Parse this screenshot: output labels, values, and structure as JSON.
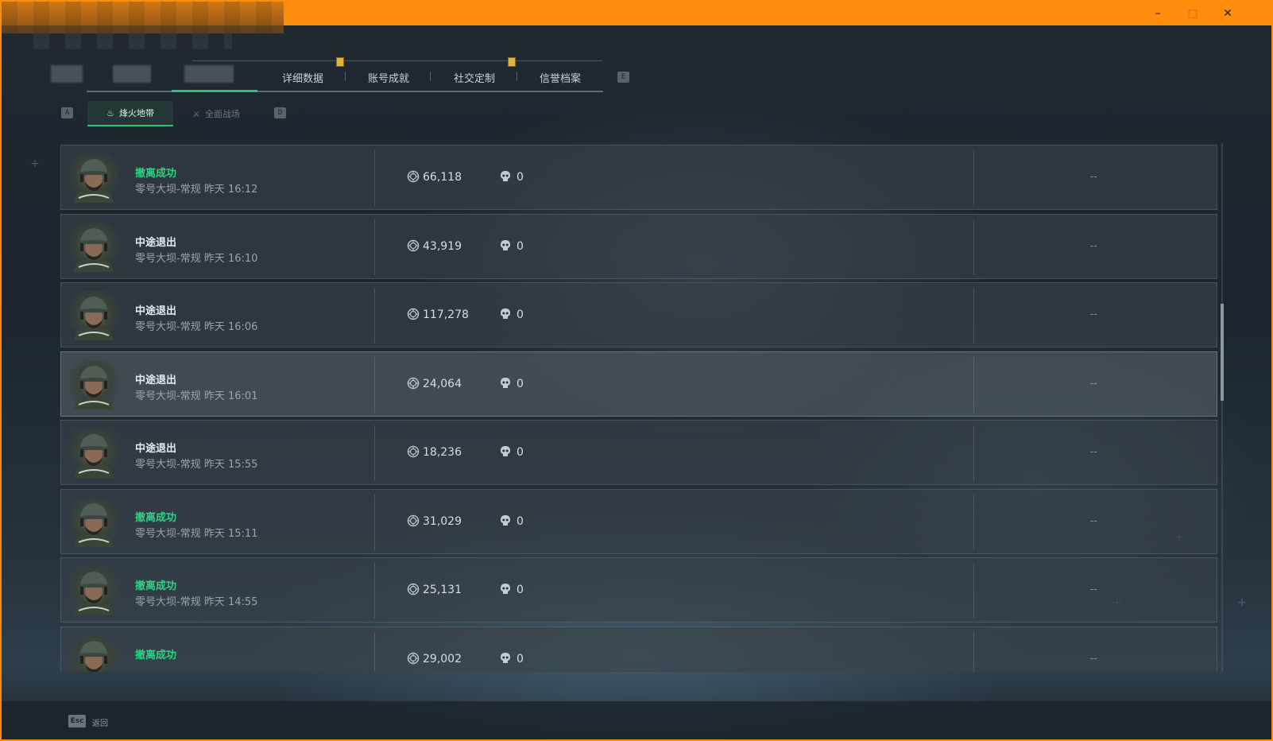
{
  "window": {
    "controls": {
      "minimize": "–",
      "maximize": "□",
      "close": "✕"
    },
    "accent_color": "#ff8c0a"
  },
  "tabs": {
    "items": [
      {
        "label": "详细数据"
      },
      {
        "label": "账号成就"
      },
      {
        "label": "社交定制"
      },
      {
        "label": "信誉档案"
      }
    ],
    "next_key": "E",
    "prev_key": "Q"
  },
  "subtabs": {
    "prev_key": "A",
    "next_key": "D",
    "items": [
      {
        "label": "烽火地带",
        "icon": "fire-zone-icon",
        "active": true
      },
      {
        "label": "全面战场",
        "icon": "battlefield-icon",
        "active": false
      }
    ]
  },
  "matches": [
    {
      "status": "撤离成功",
      "status_type": "success",
      "map": "零号大坝-常规",
      "time": "昨天 16:12",
      "value": "66,118",
      "kills": "0",
      "extra": "--"
    },
    {
      "status": "中途退出",
      "status_type": "quit",
      "map": "零号大坝-常规",
      "time": "昨天 16:10",
      "value": "43,919",
      "kills": "0",
      "extra": "--"
    },
    {
      "status": "中途退出",
      "status_type": "quit",
      "map": "零号大坝-常规",
      "time": "昨天 16:06",
      "value": "117,278",
      "kills": "0",
      "extra": "--"
    },
    {
      "status": "中途退出",
      "status_type": "quit",
      "map": "零号大坝-常规",
      "time": "昨天 16:01",
      "value": "24,064",
      "kills": "0",
      "extra": "--"
    },
    {
      "status": "中途退出",
      "status_type": "quit",
      "map": "零号大坝-常规",
      "time": "昨天 15:55",
      "value": "18,236",
      "kills": "0",
      "extra": "--"
    },
    {
      "status": "撤离成功",
      "status_type": "success",
      "map": "零号大坝-常规",
      "time": "昨天 15:11",
      "value": "31,029",
      "kills": "0",
      "extra": "--"
    },
    {
      "status": "撤离成功",
      "status_type": "success",
      "map": "零号大坝-常规",
      "time": "昨天 14:55",
      "value": "25,131",
      "kills": "0",
      "extra": "--"
    },
    {
      "status": "撤离成功",
      "status_type": "success",
      "map": "",
      "time": "",
      "value": "29,002",
      "kills": "0",
      "extra": "--"
    }
  ],
  "colors": {
    "success": "#2dd385",
    "quit": "#e6eaed",
    "active_tab": "#2fbf7a"
  },
  "footer": {
    "esc_key": "Esc",
    "back_label": "返回"
  }
}
